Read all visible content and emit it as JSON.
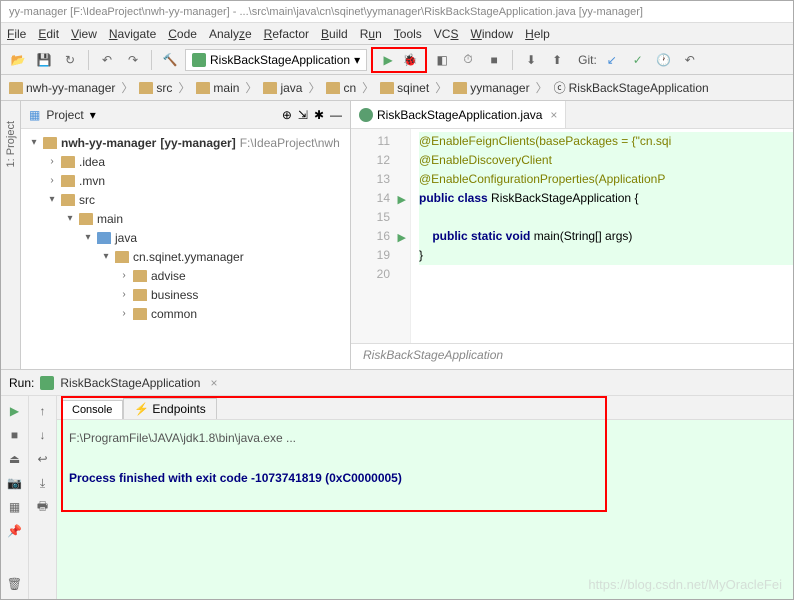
{
  "titlebar": "yy-manager [F:\\IdeaProject\\nwh-yy-manager] - ...\\src\\main\\java\\cn\\sqinet\\yymanager\\RiskBackStageApplication.java [yy-manager]",
  "menu": [
    "File",
    "Edit",
    "View",
    "Navigate",
    "Code",
    "Analyze",
    "Refactor",
    "Build",
    "Run",
    "Tools",
    "VCS",
    "Window",
    "Help"
  ],
  "runConfig": "RiskBackStageApplication",
  "gitLabel": "Git:",
  "breadcrumb": [
    "nwh-yy-manager",
    "src",
    "main",
    "java",
    "cn",
    "sqinet",
    "yymanager",
    "RiskBackStageApplication"
  ],
  "projectTitle": "Project",
  "tree": {
    "root": "nwh-yy-manager",
    "rootTag": "[yy-manager]",
    "rootPath": "F:\\IdeaProject\\nwh",
    "items": [
      ".idea",
      ".mvn",
      "src",
      "main",
      "java",
      "cn.sqinet.yymanager",
      "advise",
      "business",
      "common"
    ]
  },
  "editorTab": "RiskBackStageApplication.java",
  "lines": [
    "11",
    "12",
    "13",
    "14",
    "15",
    "16",
    "19",
    "20"
  ],
  "code": {
    "l11": "@EnableFeignClients(basePackages = {\"cn.sqi",
    "l12": "@EnableDiscoveryClient",
    "l13": "@EnableConfigurationProperties(ApplicationP",
    "l14a": "public class ",
    "l14b": "RiskBackStageApplication",
    "l14c": " {",
    "l16a": "    public static void ",
    "l16b": "main",
    "l16c": "(String[] args)",
    "l19": "}"
  },
  "codeFooter": "RiskBackStageApplication",
  "runTool": {
    "label": "Run:",
    "title": "RiskBackStageApplication",
    "tabs": [
      "Console",
      "Endpoints"
    ],
    "console": {
      "line1": "F:\\ProgramFile\\JAVA\\jdk1.8\\bin\\java.exe ...",
      "line2": "Process finished with exit code -1073741819 (0xC0000005)"
    }
  },
  "watermark": "https://blog.csdn.net/MyOracleFei"
}
